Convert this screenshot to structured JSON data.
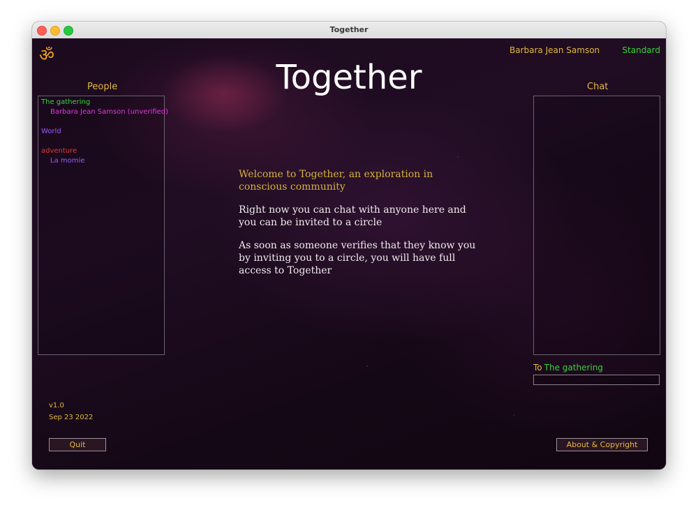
{
  "window": {
    "title": "Together"
  },
  "header": {
    "app_title": "Together",
    "logo_icon": "om-icon",
    "user_name": "Barbara Jean Samson",
    "user_level": "Standard"
  },
  "people": {
    "label": "People",
    "items": [
      {
        "text": "The gathering",
        "kind": "circle",
        "color": "#3ad33a"
      },
      {
        "text": "Barbara Jean Samson (unverified)",
        "kind": "member",
        "color": "#e03ae0"
      },
      {
        "text": "World",
        "kind": "circle",
        "color": "#9a5cff"
      },
      {
        "text": "adventure",
        "kind": "circle",
        "color": "#e03a3a"
      },
      {
        "text": "La momie",
        "kind": "member",
        "color": "#9a5cff"
      }
    ]
  },
  "chat": {
    "label": "Chat",
    "to_label": "To",
    "to_target": "The gathering",
    "input_value": ""
  },
  "welcome": {
    "heading": "Welcome to Together, an exploration in conscious community",
    "para1": "Right now you can chat with anyone here and you can be invited to a circle",
    "para2": "As soon as someone verifies that they know you by inviting you to a circle, you will have full access to Together"
  },
  "footer": {
    "version": "v1.0",
    "date": "Sep 23 2022",
    "quit_label": "Quit",
    "about_label": "About & Copyright"
  },
  "colors": {
    "accent_gold": "#e2b93e",
    "accent_green": "#3ad33a",
    "background": "#1a0d1c"
  }
}
